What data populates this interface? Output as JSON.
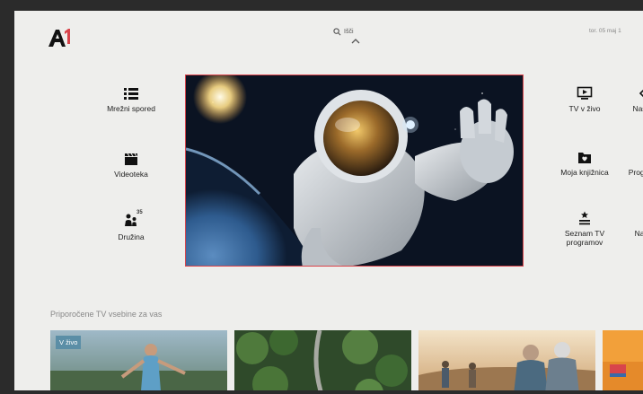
{
  "header": {
    "search_label": "Išči",
    "date_text": "tor. 05 maj 1"
  },
  "left_menu": [
    {
      "label": "Mrežni spored",
      "icon": "list-icon"
    },
    {
      "label": "Videoteka",
      "icon": "clapperboard-icon"
    },
    {
      "label": "Družina",
      "icon": "family-icon"
    }
  ],
  "family_badge": "35",
  "right_menu_col1": [
    {
      "label": "TV v živo",
      "icon": "tv-play-icon"
    },
    {
      "label": "Moja knjižnica",
      "icon": "folder-heart-icon"
    },
    {
      "label": "Seznam TV programov",
      "icon": "star-list-icon"
    }
  ],
  "right_menu_col2": [
    {
      "label": "Nas",
      "icon": "partial-icon"
    },
    {
      "label": "Prog v",
      "icon": "partial-icon"
    },
    {
      "label": "Na",
      "icon": "partial-icon"
    }
  ],
  "hero": {
    "image": "astronaut-in-space-over-earth"
  },
  "recommendations": {
    "title": "Priporočene TV vsebine za vas",
    "tiles": [
      {
        "badge": "V živo",
        "image": "woman-arms-outstretched-outdoors"
      },
      {
        "image": "aerial-forest-road"
      },
      {
        "image": "hikers-on-hill-at-sunset"
      },
      {
        "image": "orange-partial-tile"
      }
    ]
  },
  "colors": {
    "accent_red": "#d8444b",
    "badge_blue": "#5b8ea6",
    "background": "#eeeeec"
  }
}
